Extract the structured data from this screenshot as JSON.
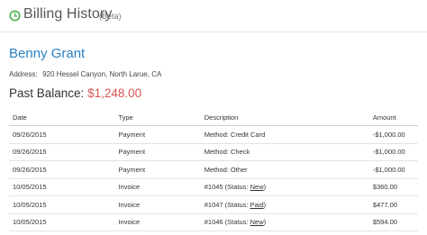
{
  "header": {
    "icon": "clock-icon",
    "accent_color": "#4caf50",
    "title": "Billing History",
    "beta_label": "(Beta)"
  },
  "customer": {
    "name": "Benny Grant",
    "address_label": "Address:",
    "address_value": "920 Hessel Canyon, North Larue, CA",
    "balance_label": "Past Balance:",
    "balance_value": "$1,248.00",
    "balance_color": "#d9534f",
    "name_color": "#2a82c4"
  },
  "table": {
    "columns": [
      "Date",
      "Type",
      "Description",
      "Amount"
    ],
    "rows": [
      {
        "date": "09/26/2015",
        "type": "Payment",
        "desc_prefix": "Method: Credit Card",
        "status": null,
        "desc_suffix": "",
        "amount": "-$1,000.00"
      },
      {
        "date": "09/26/2015",
        "type": "Payment",
        "desc_prefix": "Method: Check",
        "status": null,
        "desc_suffix": "",
        "amount": "-$1,000.00"
      },
      {
        "date": "09/26/2015",
        "type": "Payment",
        "desc_prefix": "Method: Other",
        "status": null,
        "desc_suffix": "",
        "amount": "-$1,000.00"
      },
      {
        "date": "10/05/2015",
        "type": "Invoice",
        "desc_prefix": "#1045 (Status: ",
        "status": "New",
        "desc_suffix": ")",
        "amount": "$360.00"
      },
      {
        "date": "10/05/2015",
        "type": "Invoice",
        "desc_prefix": "#1047 (Status: ",
        "status": "Paid",
        "desc_suffix": ")",
        "amount": "$477.00"
      },
      {
        "date": "10/05/2015",
        "type": "Invoice",
        "desc_prefix": "#1046 (Status: ",
        "status": "New",
        "desc_suffix": ")",
        "amount": "$594.00"
      }
    ]
  }
}
